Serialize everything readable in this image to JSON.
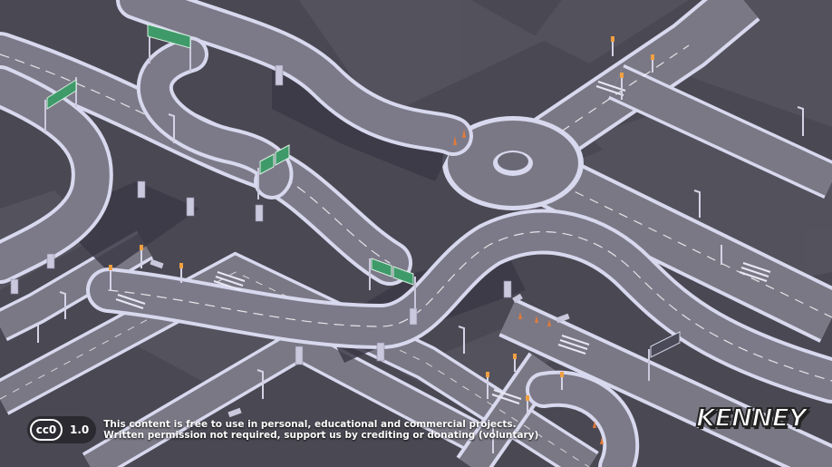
{
  "license": {
    "badge_text": "cc0",
    "version": "1.0",
    "line1": "This content is free to use in personal, educational and commercial projects.",
    "line2": "Written permission not required, support us by crediting or donating (voluntary)"
  },
  "brand": {
    "name": "KENNEY"
  },
  "colors": {
    "ground": "#4a4852",
    "lot": "#5a5862",
    "road": "#7a7884",
    "curb": "#d8d8ee",
    "shadow": "#3a3842",
    "sign": "#3f9a6a",
    "cone": "#e07a3a"
  }
}
